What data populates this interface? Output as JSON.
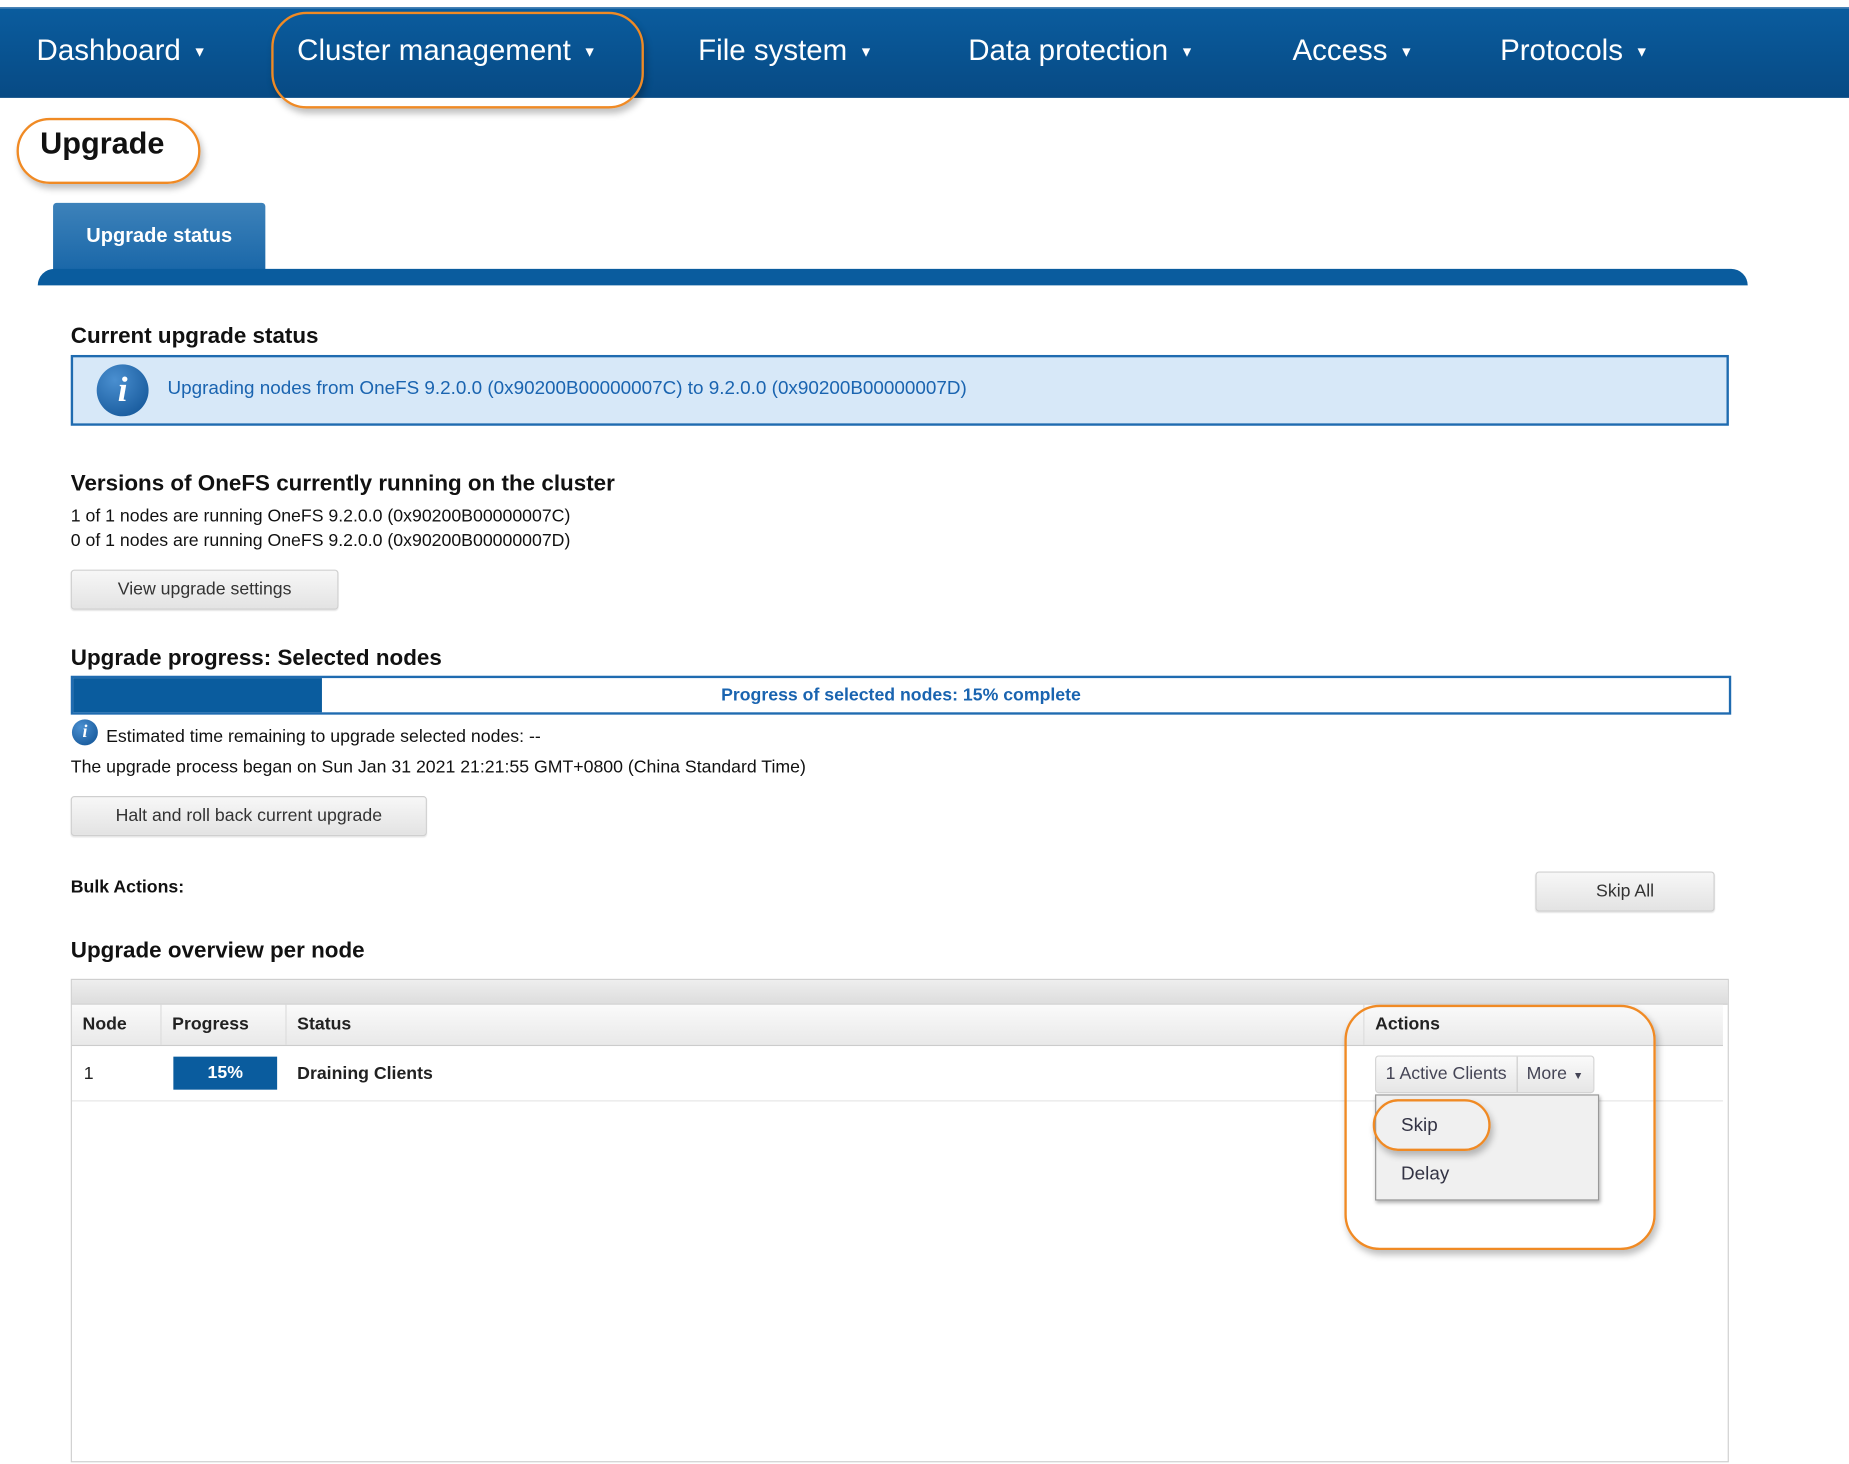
{
  "nav": {
    "items": [
      {
        "label": "Dashboard"
      },
      {
        "label": "Cluster management"
      },
      {
        "label": "File system"
      },
      {
        "label": "Data protection"
      },
      {
        "label": "Access"
      },
      {
        "label": "Protocols"
      }
    ],
    "caret": "▼"
  },
  "page": {
    "title": "Upgrade"
  },
  "tabs": [
    {
      "label": "Upgrade status"
    }
  ],
  "current_status": {
    "heading": "Current upgrade status",
    "message": "Upgrading nodes from OneFS 9.2.0.0 (0x90200B00000007C) to 9.2.0.0 (0x90200B00000007D)",
    "icon": "info-icon",
    "icon_glyph": "i"
  },
  "versions": {
    "heading": "Versions of OneFS currently running on the cluster",
    "lines": [
      "1 of 1 nodes are running OneFS 9.2.0.0 (0x90200B00000007C)",
      "0 of 1 nodes are running OneFS 9.2.0.0 (0x90200B00000007D)"
    ],
    "button": "View upgrade settings"
  },
  "progress": {
    "heading": "Upgrade progress: Selected nodes",
    "percent": 15,
    "bar_text": "Progress of selected nodes: 15% complete",
    "estimate": "Estimated time remaining to upgrade selected nodes: --",
    "began": "The upgrade process began on Sun Jan 31 2021 21:21:55 GMT+0800 (China Standard Time)",
    "halt_button": "Halt and roll back current upgrade"
  },
  "bulk": {
    "label": "Bulk Actions:",
    "skip_all": "Skip All"
  },
  "overview": {
    "heading": "Upgrade overview per node",
    "columns": [
      "Node",
      "Progress",
      "Status",
      "Actions"
    ],
    "rows": [
      {
        "node": "1",
        "progress": "15%",
        "status": "Draining Clients",
        "action_primary": "1 Active Clients",
        "action_more": "More"
      }
    ],
    "more_menu": [
      "Skip",
      "Delay"
    ]
  },
  "colors": {
    "brand": "#0a5c9e",
    "highlight": "#f08a24",
    "info_bg": "#d7e8f8"
  }
}
